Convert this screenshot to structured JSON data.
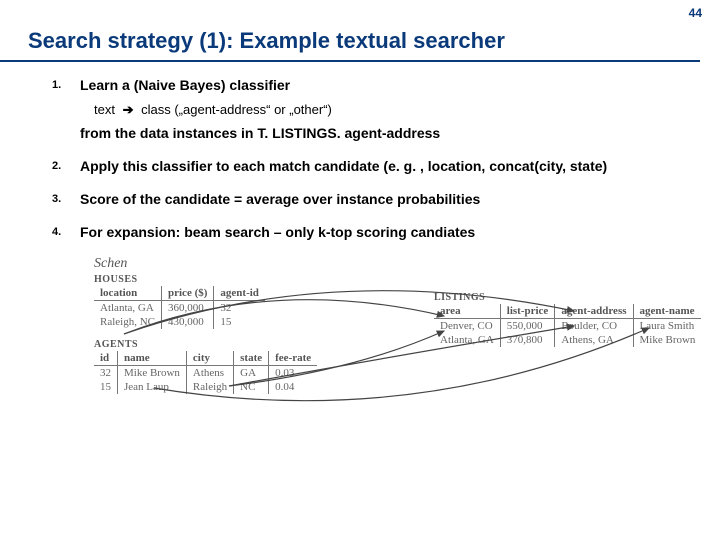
{
  "page_number": "44",
  "title": "Search strategy (1): Example textual searcher",
  "items": [
    {
      "lead": "Learn a (Naive Bayes) classifier",
      "sub_pre": "text",
      "sub_post": "class („agent-address“ or „other“)",
      "from": "from the data instances in T. LISTINGS. agent-address"
    },
    {
      "lead": "Apply this classifier to each match candidate (e. g. , location, concat(city, state)"
    },
    {
      "lead": "Score of the candidate = average over instance probabilities"
    },
    {
      "lead": "For expansion: beam search – only k-top scoring candiates"
    }
  ],
  "figure": {
    "schema_label": "Schen",
    "houses": {
      "caption": "HOUSES",
      "headers": [
        "location",
        "price ($)",
        "agent-id"
      ],
      "rows": [
        [
          "Atlanta, GA",
          "360,000",
          "32"
        ],
        [
          "Raleigh, NC",
          "430,000",
          "15"
        ]
      ]
    },
    "agents": {
      "caption": "AGENTS",
      "headers": [
        "id",
        "name",
        "city",
        "state",
        "fee-rate"
      ],
      "rows": [
        [
          "32",
          "Mike Brown",
          "Athens",
          "GA",
          "0.03"
        ],
        [
          "15",
          "Jean Laup",
          "Raleigh",
          "NC",
          "0.04"
        ]
      ]
    },
    "listings": {
      "caption": "LISTINGS",
      "headers": [
        "area",
        "list-price",
        "agent-address",
        "agent-name"
      ],
      "rows": [
        [
          "Denver, CO",
          "550,000",
          "Boulder, CO",
          "Laura Smith"
        ],
        [
          "Atlanta, GA",
          "370,800",
          "Athens, GA",
          "Mike Brown"
        ]
      ]
    }
  }
}
